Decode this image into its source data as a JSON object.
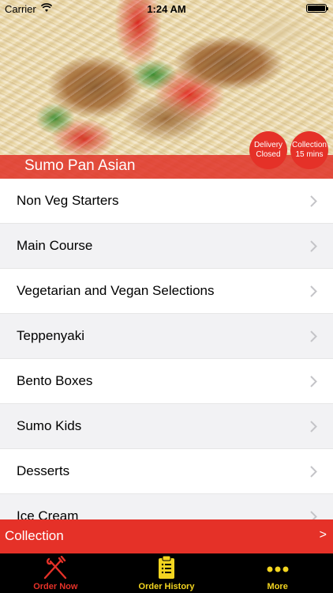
{
  "status_bar": {
    "carrier": "Carrier",
    "time": "1:24 AM"
  },
  "hero": {
    "restaurant_name": "Sumo Pan Asian",
    "delivery_status": {
      "line1": "Delivery",
      "line2": "Closed"
    },
    "collection_status": {
      "line1": "Collection",
      "line2": "15 mins"
    }
  },
  "menu": {
    "items": [
      {
        "label": "Non Veg Starters"
      },
      {
        "label": "Main Course"
      },
      {
        "label": "Vegetarian and Vegan Selections"
      },
      {
        "label": "Teppenyaki"
      },
      {
        "label": "Bento Boxes"
      },
      {
        "label": "Sumo Kids"
      },
      {
        "label": "Desserts"
      },
      {
        "label": "Ice Cream"
      }
    ]
  },
  "collection_bar": {
    "label": "Collection",
    "arrow": ">"
  },
  "tabs": [
    {
      "label": "Order Now",
      "icon": "fork-knife-icon",
      "color": "#e53128"
    },
    {
      "label": "Order History",
      "icon": "clipboard-list-icon",
      "color": "#f3d520"
    },
    {
      "label": "More",
      "icon": "more-dots-icon",
      "color": "#f3d520"
    }
  ],
  "colors": {
    "accent": "#e53128",
    "tab_active": "#e53128",
    "tab_inactive": "#f3d520"
  }
}
